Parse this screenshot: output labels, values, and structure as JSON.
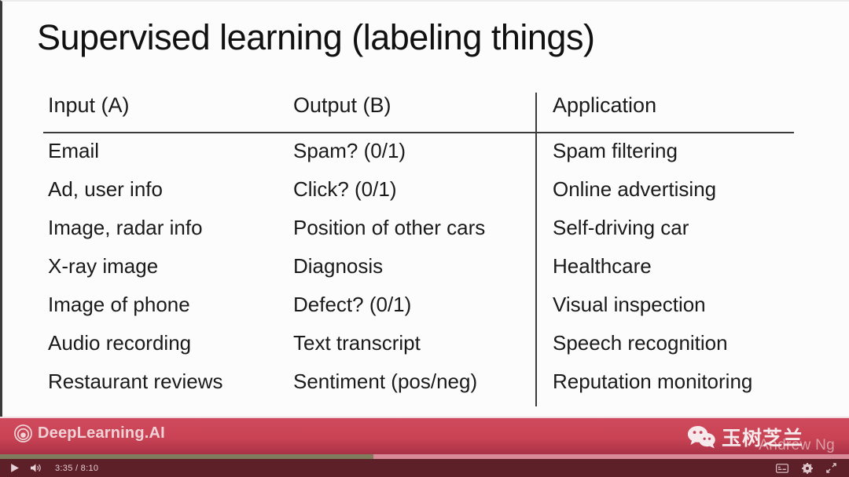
{
  "slide": {
    "title": "Supervised learning (labeling things)",
    "table": {
      "headers": [
        "Input (A)",
        "Output (B)",
        "Application"
      ],
      "rows": [
        {
          "input": "Email",
          "output": "Spam? (0/1)",
          "application": "Spam filtering"
        },
        {
          "input": "Ad, user info",
          "output": "Click? (0/1)",
          "application": "Online advertising"
        },
        {
          "input": "Image, radar info",
          "output": "Position of other cars",
          "application": "Self-driving car"
        },
        {
          "input": "X-ray image",
          "output": "Diagnosis",
          "application": "Healthcare"
        },
        {
          "input": "Image of phone",
          "output": "Defect? (0/1)",
          "application": "Visual inspection"
        },
        {
          "input": "Audio recording",
          "output": "Text transcript",
          "application": "Speech recognition"
        },
        {
          "input": "Restaurant reviews",
          "output": "Sentiment (pos/neg)",
          "application": "Reputation monitoring"
        }
      ]
    }
  },
  "banner": {
    "brand_name": "DeepLearning.AI",
    "brand_logo_icon": "spiral-logo-icon",
    "presenter": "Andrew Ng",
    "watermark_label": "玉树芝兰",
    "watermark_icon": "wechat-icon",
    "background_color": "#c94354"
  },
  "player": {
    "play_icon": "play-icon",
    "volume_icon": "volume-icon",
    "time_display": "3:35 / 8:10",
    "current_time": "3:35",
    "duration": "8:10",
    "progress_percent": 44,
    "subtitles_icon": "subtitles-icon",
    "settings_icon": "gear-icon",
    "fullscreen_icon": "fullscreen-icon",
    "played_color": "#7e7c5c",
    "track_color": "#d98a99"
  }
}
